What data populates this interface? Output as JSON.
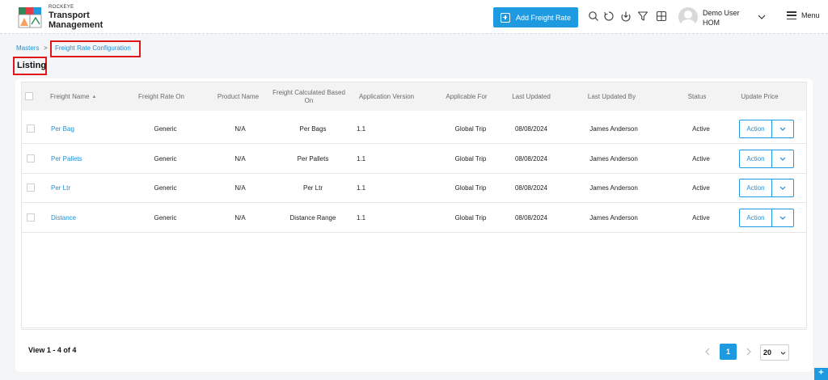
{
  "brand": {
    "small": "ROCKEYE",
    "line1": "Transport",
    "line2": "Management"
  },
  "header": {
    "add_button_label": "Add Freight Rate",
    "icons": [
      "search-icon",
      "history-icon",
      "download-icon",
      "filter-icon",
      "grid-icon"
    ],
    "user_name": "Demo User",
    "user_role": "HOM",
    "menu_label": "Menu"
  },
  "breadcrumb": {
    "root": "Masters",
    "separator": ">",
    "current": "Freight Rate Configuration"
  },
  "page_title": "Listing",
  "table": {
    "columns": [
      "Freight Name",
      "Freight Rate On",
      "Product Name",
      "Freight Calculated Based On",
      "Application Version",
      "Applicable For",
      "Last Updated",
      "Last Updated By",
      "Status",
      "Update Price"
    ],
    "sort_indicator": "▲",
    "rows": [
      {
        "freight_name": "Per Bag",
        "rate_on": "Generic",
        "product": "N/A",
        "based_on": "Per Bags",
        "version": "1.1",
        "applicable_for": "Global Trip",
        "last_updated": "08/08/2024",
        "updated_by": "James Anderson",
        "status": "Active",
        "action": "Action"
      },
      {
        "freight_name": "Per Pallets",
        "rate_on": "Generic",
        "product": "N/A",
        "based_on": "Per Pallets",
        "version": "1.1",
        "applicable_for": "Global Trip",
        "last_updated": "08/08/2024",
        "updated_by": "James Anderson",
        "status": "Active",
        "action": "Action"
      },
      {
        "freight_name": "Per Ltr",
        "rate_on": "Generic",
        "product": "N/A",
        "based_on": "Per Ltr",
        "version": "1.1",
        "applicable_for": "Global Trip",
        "last_updated": "08/08/2024",
        "updated_by": "James Anderson",
        "status": "Active",
        "action": "Action"
      },
      {
        "freight_name": "Distance",
        "rate_on": "Generic",
        "product": "N/A",
        "based_on": "Distance Range",
        "version": "1.1",
        "applicable_for": "Global Trip",
        "last_updated": "08/08/2024",
        "updated_by": "James Anderson",
        "status": "Active",
        "action": "Action"
      }
    ]
  },
  "pagination": {
    "view_text": "View 1 - 4 of 4",
    "current_page": "1",
    "page_size": "20"
  },
  "colors": {
    "accent": "#1e9be0",
    "link": "#1e8fd6",
    "highlight": "#e0161a"
  }
}
